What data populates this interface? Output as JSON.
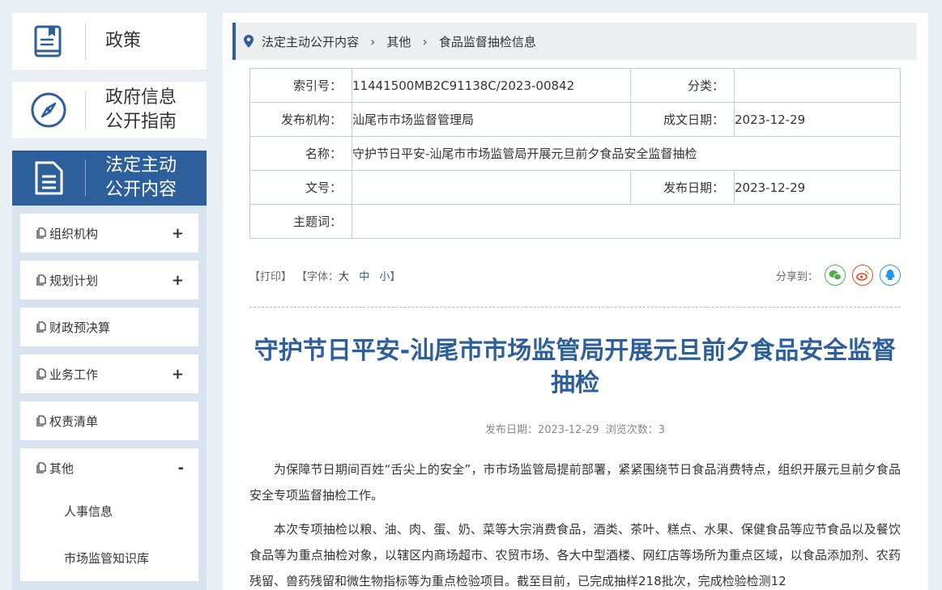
{
  "sidebar": {
    "nav": [
      {
        "label": "政策"
      },
      {
        "label_line1": "政府信息",
        "label_line2": "公开指南"
      },
      {
        "label_line1": "法定主动",
        "label_line2": "公开内容"
      }
    ],
    "items": [
      {
        "label": "组织机构",
        "toggle": "+"
      },
      {
        "label": "规划计划",
        "toggle": "+"
      },
      {
        "label": "财政预决算"
      },
      {
        "label": "业务工作",
        "toggle": "+"
      },
      {
        "label": "权责清单"
      },
      {
        "label": "其他",
        "toggle": "-",
        "children": [
          "人事信息",
          "市场监管知识库"
        ]
      }
    ]
  },
  "breadcrumb": [
    "法定主动公开内容",
    "其他",
    "食品监督抽检信息"
  ],
  "info": {
    "index_label": "索引号：",
    "index_value": "11441500MB2C91138C/2023-00842",
    "category_label": "分类：",
    "category_value": "",
    "publisher_label": "发布机构：",
    "publisher_value": "汕尾市市场监督管理局",
    "created_label": "成文日期：",
    "created_value": "2023-12-29",
    "name_label": "名称：",
    "name_value": "守护节日平安-汕尾市市场监管局开展元旦前夕食品安全监督抽检",
    "docno_label": "文号：",
    "docno_value": "",
    "pubdate_label": "发布日期：",
    "pubdate_value": "2023-12-29",
    "subject_label": "主题词：",
    "subject_value": ""
  },
  "tools": {
    "print": "【打印】",
    "font_prefix": "【字体：",
    "font_large": "大",
    "font_medium": "中",
    "font_small": "小",
    "font_suffix": "】",
    "share": "分享到："
  },
  "article": {
    "title": "守护节日平安-汕尾市市场监管局开展元旦前夕食品安全监督抽检",
    "meta": "发布日期：2023-12-29  浏览次数：3",
    "p1": "为保障节日期间百姓“舌尖上的安全”，市市场监管局提前部署，紧紧围绕节日食品消费特点，组织开展元旦前夕食品安全专项监督抽检工作。",
    "p2": "本次专项抽检以粮、油、肉、蛋、奶、菜等大宗消费食品，酒类、茶叶、糕点、水果、保健食品等应节食品以及餐饮食品等为重点抽检对象，以辖区内商场超市、农贸市场、各大中型酒楼、网红店等场所为重点区域，以食品添加剂、农药残留、兽药残留和微生物指标等为重点检验项目。截至目前，已完成抽样218批次，完成检验检测12"
  },
  "colors": {
    "accent": "#2d5f9c",
    "wechat": "#4caf50",
    "weibo": "#e64a19",
    "qq": "#2196f3"
  }
}
